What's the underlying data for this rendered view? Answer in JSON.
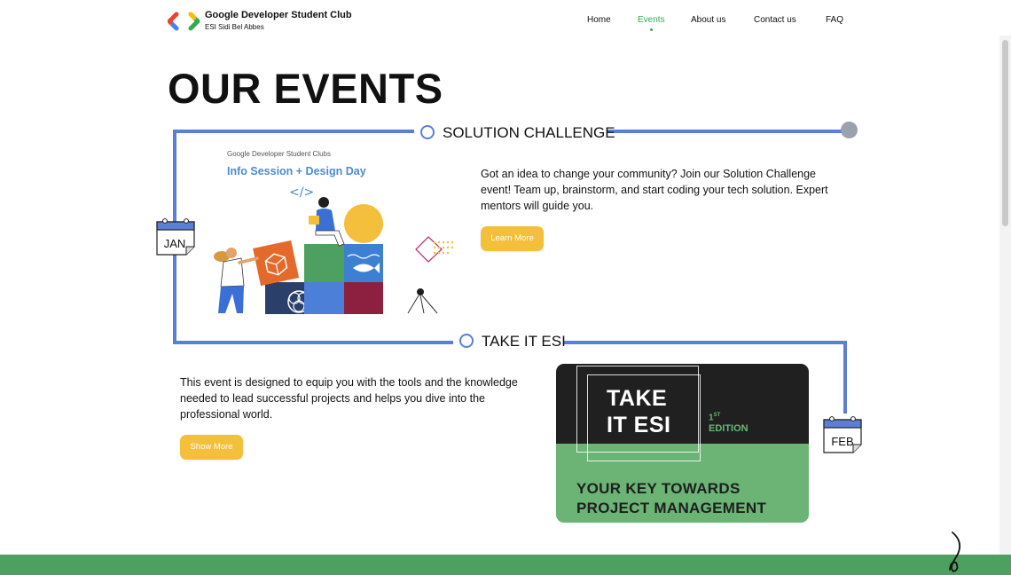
{
  "header": {
    "brand_title": "Google Developer Student Club",
    "brand_subtitle": "ESI Sidi Bel Abbes",
    "nav": [
      {
        "label": "Home",
        "active": false
      },
      {
        "label": "Events",
        "active": true
      },
      {
        "label": "About us",
        "active": false
      },
      {
        "label": "Contact us",
        "active": false
      },
      {
        "label": "FAQ",
        "active": false
      }
    ]
  },
  "page": {
    "heading": "OUR EVENTS"
  },
  "events": [
    {
      "title": "SOLUTION CHALLENGE",
      "month": "JAN",
      "illustration_title": "Info Session + Design Day",
      "illustration_top_text": "Google Developer Student Clubs",
      "illustration_code": "</>",
      "description": "Got an idea to change your community? Join our Solution Challenge event! Team up, brainstorm, and start coding your tech solution. Expert mentors will guide you.",
      "button": "Learn More"
    },
    {
      "title": "TAKE IT ESI",
      "month": "FEB",
      "description": "This event is designed to equip you with the tools and the knowledge needed to lead successful projects and helps you dive into the professional world.",
      "button": "Show More",
      "card": {
        "title_line1": "TAKE",
        "title_line2": "IT ESI",
        "edition_num": "1",
        "edition_suffix": "ST",
        "edition_label": "EDITION",
        "subtitle_line1": "YOUR KEY TOWARDS",
        "subtitle_line2": "PROJECT MANAGEMENT"
      }
    }
  ],
  "colors": {
    "accent_green": "#34a853",
    "timeline_blue": "#5b7fd6",
    "button_yellow": "#f4bf3a",
    "footer_green": "#4da05f"
  }
}
